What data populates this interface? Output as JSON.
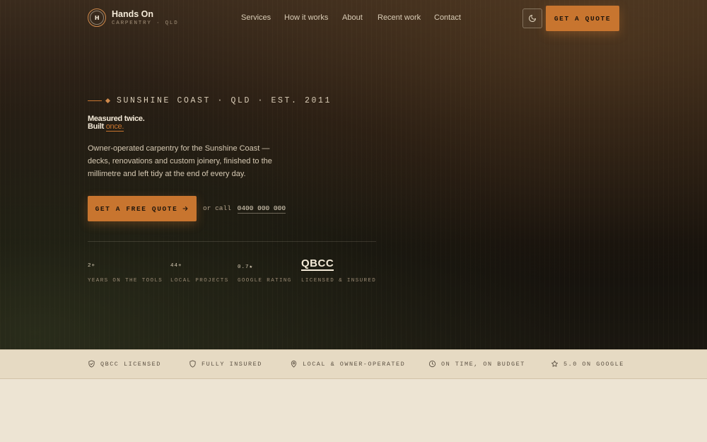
{
  "nav": {
    "brand": {
      "mark": "H",
      "name": "Hands On",
      "tagline": "CARPENTRY · QLD"
    },
    "links": [
      "Services",
      "How it works",
      "About",
      "Recent work",
      "Contact"
    ],
    "theme_toggle_icon": "moon-icon",
    "quote_button": "GET A QUOTE"
  },
  "hero": {
    "eyebrow": "SUNSHINE COAST · QLD · EST. 2011",
    "headline_line1": "Measured twice.",
    "headline_line2_prefix": "Built",
    "headline_line2_accent": "once.",
    "lead": "Owner-operated carpentry for the Sunshine Coast — decks, renovations and custom joinery, finished to the millimetre and left tidy at the end of every day.",
    "cta_label": "GET A FREE QUOTE",
    "call_prefix": "or call",
    "phone": "0400 000 000"
  },
  "stats": [
    {
      "value": "2+",
      "label": "YEARS ON THE TOOLS"
    },
    {
      "value": "44+",
      "label": "LOCAL PROJECTS"
    },
    {
      "value": "0.7★",
      "label": "GOOGLE RATING"
    },
    {
      "value": "QBCC",
      "label": "LICENSED & INSURED"
    }
  ],
  "trust_band": [
    {
      "icon": "shield-check-icon",
      "label": "QBCC LICENSED"
    },
    {
      "icon": "shield-icon",
      "label": "FULLY INSURED"
    },
    {
      "icon": "map-pin-icon",
      "label": "LOCAL & OWNER-OPERATED"
    },
    {
      "icon": "clock-icon",
      "label": "ON TIME, ON BUDGET"
    },
    {
      "icon": "star-icon",
      "label": "5.0 ON GOOGLE"
    }
  ],
  "colors": {
    "accent": "#c8752f",
    "hero_bg": "#1a140e",
    "band_bg": "#e6dac3",
    "page_bg": "#ede4d3"
  }
}
